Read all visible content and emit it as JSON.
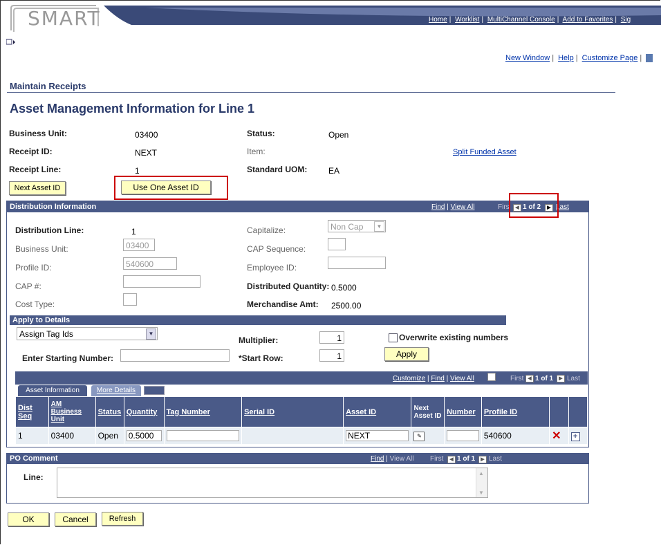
{
  "header": {
    "logo": "SMART",
    "nav_links": [
      "Home",
      "Worklist",
      "MultiChannel Console",
      "Add to Favorites",
      "Sig"
    ],
    "sub_links": [
      "New Window",
      "Help",
      "Customize Page"
    ]
  },
  "page": {
    "breadcrumb": "Maintain Receipts",
    "title": "Asset Management Information for Line 1"
  },
  "summary": {
    "business_unit_label": "Business Unit:",
    "business_unit": "03400",
    "status_label": "Status:",
    "status": "Open",
    "receipt_id_label": "Receipt ID:",
    "receipt_id": "NEXT",
    "item_label": "Item:",
    "split_funded_link": "Split Funded Asset",
    "receipt_line_label": "Receipt Line:",
    "receipt_line": "1",
    "uom_label": "Standard UOM:",
    "uom": "EA",
    "next_asset_btn": "Next Asset ID",
    "use_one_asset_btn": "Use One Asset ID"
  },
  "distribution": {
    "header": "Distribution Information",
    "find": "Find",
    "view_all": "View All",
    "first": "Firs",
    "counter": "1 of 2",
    "last": "Last",
    "dist_line_label": "Distribution Line:",
    "dist_line": "1",
    "capitalize_label": "Capitalize:",
    "capitalize_value": "Non Cap",
    "bu_label": "Business Unit:",
    "bu_value": "03400",
    "cap_seq_label": "CAP Sequence:",
    "cap_seq_value": "",
    "profile_label": "Profile ID:",
    "profile_value": "540600",
    "employee_label": "Employee ID:",
    "employee_value": "",
    "cap_label": "CAP #:",
    "cap_value": "",
    "dist_qty_label": "Distributed Quantity:",
    "dist_qty": "0.5000",
    "cost_type_label": "Cost Type:",
    "merch_amt_label": "Merchandise Amt:",
    "merch_amt": "2500.00"
  },
  "apply": {
    "header": "Apply to Details",
    "select_value": "Assign Tag Ids",
    "multiplier_label": "Multiplier:",
    "multiplier": "1",
    "overwrite_label": "Overwrite existing numbers",
    "starting_label": "Enter Starting Number:",
    "starting_value": "",
    "start_row_label": "*Start Row:",
    "start_row": "1",
    "apply_btn": "Apply"
  },
  "grid": {
    "customize": "Customize",
    "find": "Find",
    "view_all": "View All",
    "first": "First",
    "counter": "1 of 1",
    "last": "Last",
    "tabs": [
      "Asset Information",
      "More Details"
    ],
    "columns": [
      "Dist Seq",
      "AM Business Unit",
      "Status",
      "Quantity",
      "Tag Number",
      "Serial ID",
      "Asset ID",
      "Next Asset ID",
      "Number",
      "Profile ID"
    ],
    "rows": [
      {
        "dist_seq": "1",
        "bu": "03400",
        "status": "Open",
        "quantity": "0.5000",
        "tag": "",
        "serial": "",
        "asset_id": "NEXT",
        "number": "",
        "profile": "540600"
      }
    ]
  },
  "po_comment": {
    "header": "PO Comment",
    "find": "Find",
    "view_all": "View All",
    "first": "First",
    "counter": "1 of 1",
    "last": "Last",
    "line_label": "Line:",
    "line_value": ""
  },
  "footer": {
    "ok": "OK",
    "cancel": "Cancel",
    "refresh": "Refresh"
  },
  "colors": {
    "header_bar": "#4a5a88",
    "button_bg": "#ffffc0",
    "highlight": "#cc0000"
  }
}
